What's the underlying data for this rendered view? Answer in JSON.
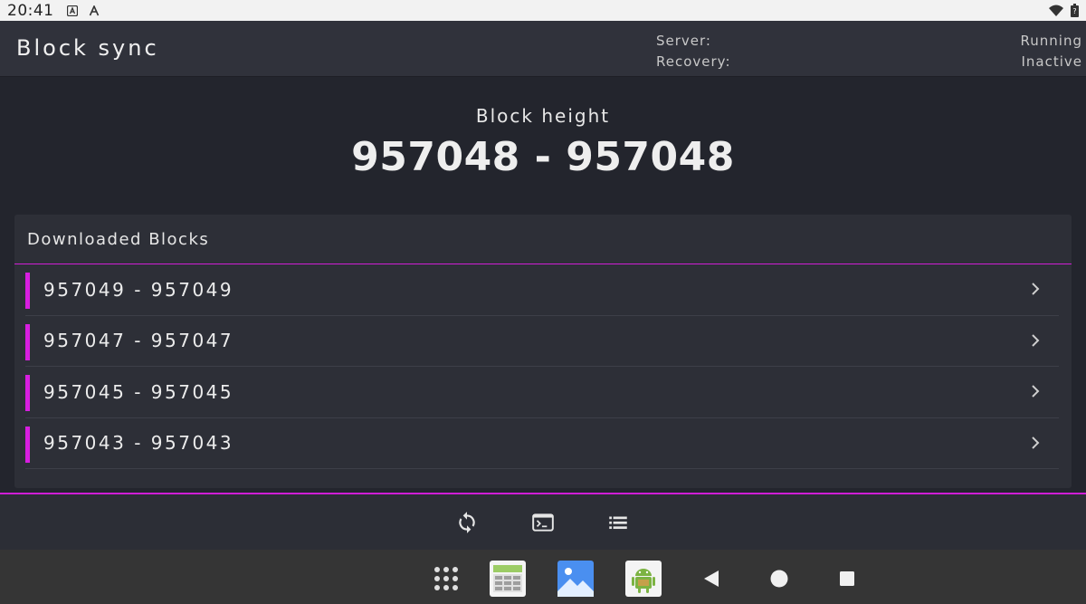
{
  "status_bar": {
    "time": "20:41",
    "icons_left": [
      "a-square-icon",
      "a-font-icon"
    ],
    "icons_right": [
      "wifi-icon",
      "battery-icon"
    ]
  },
  "header": {
    "title": "Block sync",
    "server_label": "Server:",
    "recovery_label": "Recovery:",
    "server_status": "Running",
    "recovery_status": "Inactive"
  },
  "block_height": {
    "label": "Block height",
    "value": "957048 - 957048"
  },
  "downloaded_blocks": {
    "title": "Downloaded Blocks",
    "items": [
      {
        "range": "957049 - 957049"
      },
      {
        "range": "957047 - 957047"
      },
      {
        "range": "957045 - 957045"
      },
      {
        "range": "957043 - 957043"
      }
    ]
  },
  "bottom_nav": {
    "items": [
      "sync-icon",
      "terminal-icon",
      "list-icon"
    ]
  },
  "system_nav": {
    "items": [
      "app-grid-icon",
      "calculator-app-icon",
      "gallery-app-icon",
      "android-app-icon",
      "back-icon",
      "home-icon",
      "recents-icon"
    ]
  },
  "colors": {
    "accent": "#d81ee0",
    "background": "#23252d",
    "card": "#2d2f37"
  }
}
